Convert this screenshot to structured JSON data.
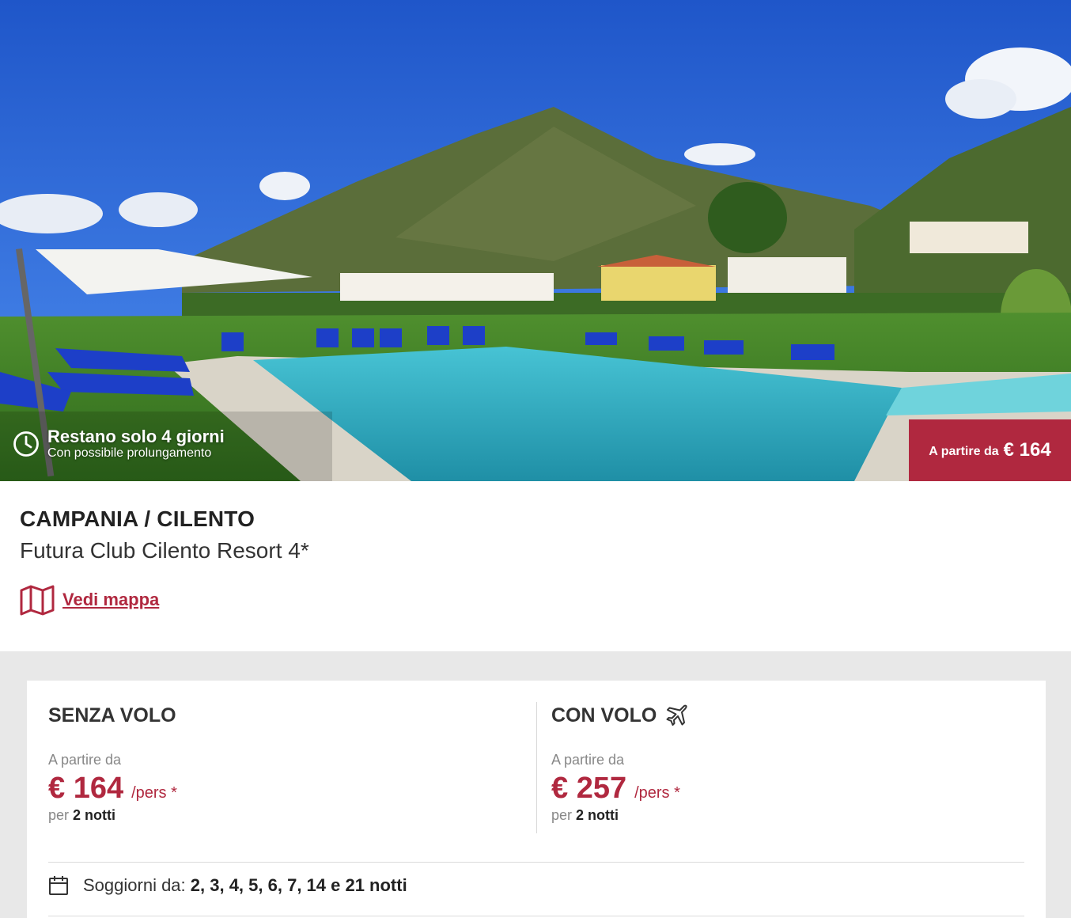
{
  "hero": {
    "countdown_title": "Restano solo 4 giorni",
    "countdown_subtitle": "Con possibile prolungamento",
    "badge_label": "A partire da",
    "badge_price": "€ 164"
  },
  "info": {
    "region": "CAMPANIA / CILENTO",
    "hotel_name": "Futura Club Cilento Resort 4*",
    "map_link": "Vedi mappa"
  },
  "offers": {
    "without_flight": {
      "title": "SENZA VOLO",
      "from_label": "A partire da",
      "price": "€ 164",
      "unit": "/pers *",
      "nights_prefix": "per",
      "nights": "2 notti"
    },
    "with_flight": {
      "title": "CON VOLO",
      "from_label": "A partire da",
      "price": "€ 257",
      "unit": "/pers *",
      "nights_prefix": "per",
      "nights": "2 notti"
    }
  },
  "stays": {
    "label": "Soggiorni da:",
    "values": "2, 3, 4, 5, 6, 7, 14 e 21 notti"
  },
  "colors": {
    "accent": "#b0283f",
    "gray_background": "#e8e8e8"
  },
  "icons": [
    "clock-icon",
    "map-icon",
    "plane-icon",
    "calendar-icon"
  ]
}
